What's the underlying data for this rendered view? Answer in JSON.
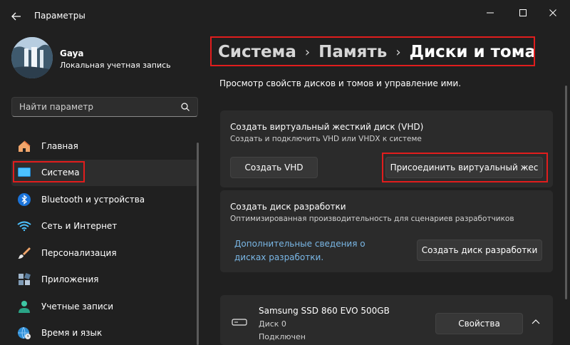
{
  "window": {
    "title": "Параметры"
  },
  "user": {
    "name": "Gaya",
    "account_type": "Локальная учетная запись"
  },
  "search": {
    "placeholder": "Найти параметр"
  },
  "nav": {
    "items": [
      {
        "label": "Главная",
        "icon": "home-icon"
      },
      {
        "label": "Система",
        "icon": "system-icon",
        "active": true
      },
      {
        "label": "Bluetooth и устройства",
        "icon": "bluetooth-icon"
      },
      {
        "label": "Сеть и Интернет",
        "icon": "wifi-icon"
      },
      {
        "label": "Персонализация",
        "icon": "brush-icon"
      },
      {
        "label": "Приложения",
        "icon": "apps-icon"
      },
      {
        "label": "Учетные записи",
        "icon": "person-icon"
      },
      {
        "label": "Время и язык",
        "icon": "globe-clock-icon"
      }
    ]
  },
  "breadcrumb": {
    "items": [
      "Система",
      "Память",
      "Диски и тома"
    ]
  },
  "page": {
    "description": "Просмотр свойств дисков и томов и управление ими."
  },
  "vhd_card": {
    "title": "Создать виртуальный жесткий диск (VHD)",
    "subtitle": "Создать и подключить VHD или VHDX к системе",
    "create_label": "Создать VHD",
    "attach_label": "Присоединить виртуальный жес"
  },
  "dev_card": {
    "title": "Создать диск разработки",
    "subtitle": "Оптимизированная производительность для сценариев разработчиков",
    "link_label": "Дополнительные сведения о дисках разработки.",
    "create_label": "Создать диск разработки"
  },
  "disk_card": {
    "name": "Samsung SSD 860 EVO 500GB",
    "number": "Диск 0",
    "status": "Подключен",
    "properties_label": "Свойства"
  },
  "colors": {
    "accent": "#4cc2ff",
    "link": "#7ab7e6",
    "highlight": "#e11d1d",
    "background": "#202020",
    "card": "#2b2b2b"
  }
}
